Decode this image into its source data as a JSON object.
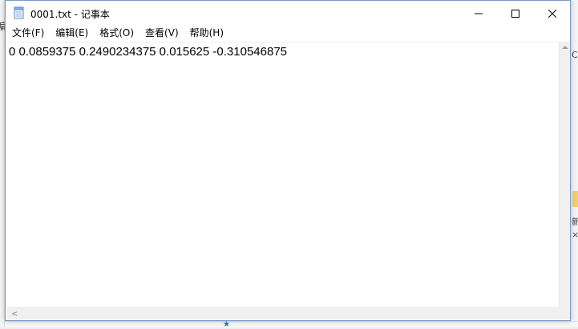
{
  "window": {
    "title": "0001.txt - 记事本",
    "icon": "notepad-icon"
  },
  "menubar": {
    "items": [
      {
        "label": "文件(F)"
      },
      {
        "label": "编辑(E)"
      },
      {
        "label": "格式(O)"
      },
      {
        "label": "查看(V)"
      },
      {
        "label": "帮助(H)"
      }
    ]
  },
  "editor": {
    "content": "0 0.0859375 0.2490234375 0.015625 -0.310546875"
  },
  "scroll": {
    "left_arrow": "<",
    "right_arrow": ">"
  },
  "colors": {
    "window_border": "#7a9cc6",
    "scrollbar": "#f0f0f0"
  }
}
